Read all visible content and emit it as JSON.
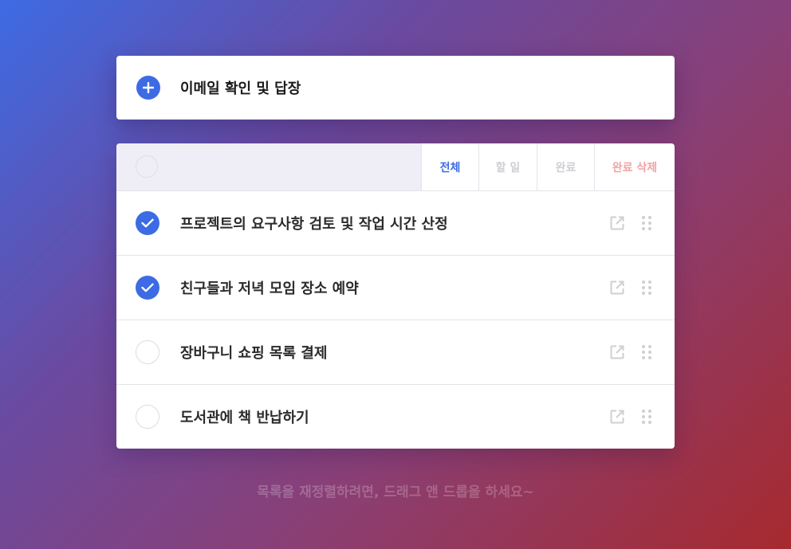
{
  "new_todo": {
    "value": "이메일 확인 및 답장",
    "add_icon": "plus-icon"
  },
  "filters": {
    "all": "전체",
    "active": "할 일",
    "completed": "완료",
    "clear": "완료 삭제"
  },
  "todos": [
    {
      "text": "프로젝트의 요구사항 검토 및 작업 시간 산정",
      "done": true
    },
    {
      "text": "친구들과 저녁 모임 장소 예약",
      "done": true
    },
    {
      "text": "장바구니 쇼핑 목록 결제",
      "done": false
    },
    {
      "text": "도서관에 책 반납하기",
      "done": false
    }
  ],
  "hint": "목록을 재정렬하려면, 드래그 앤 드롭을 하세요~",
  "colors": {
    "accent": "#3d6be4",
    "clear": "#f2a3a3"
  }
}
